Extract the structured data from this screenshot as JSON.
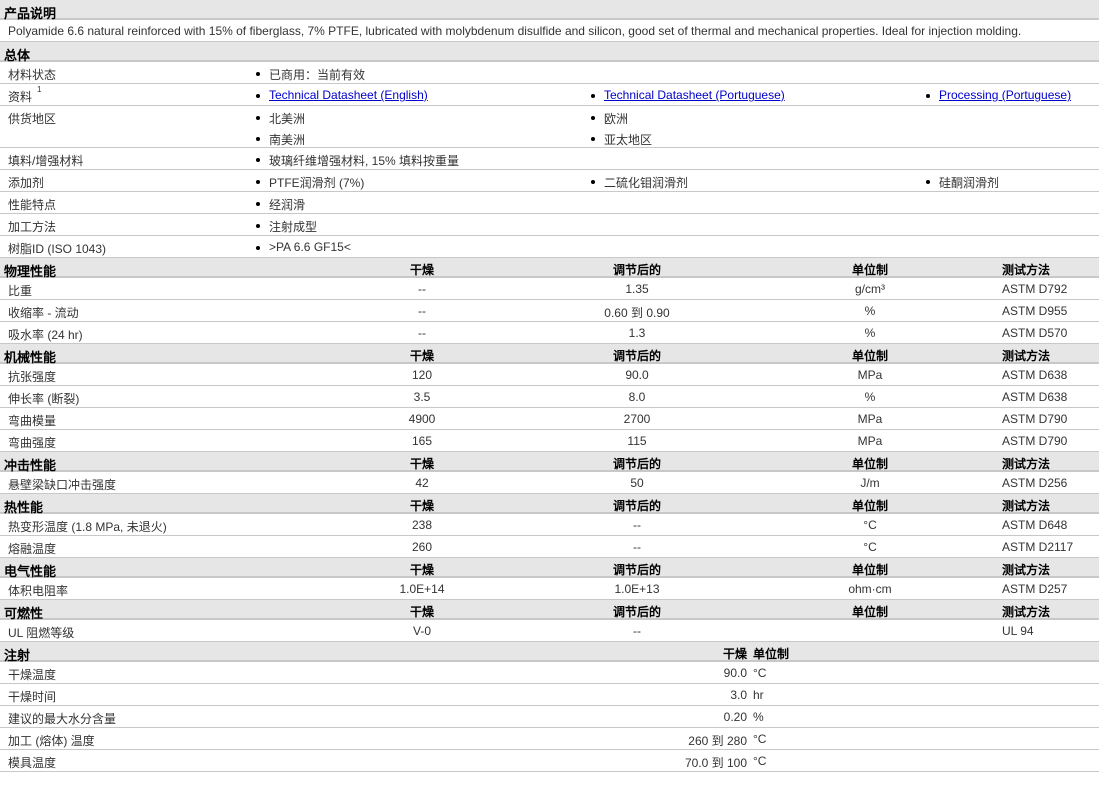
{
  "description": {
    "title": "产品说明",
    "text": "Polyamide 6.6 natural reinforced with 15% of fiberglass, 7% PTFE, lubricated with molybdenum disulfide and silicon, good set of thermal and mechanical properties. Ideal for injection molding."
  },
  "general": {
    "title": "总体",
    "rows": [
      {
        "label": "材料状态",
        "values": [
          "已商用：当前有效"
        ]
      },
      {
        "label": "资料",
        "sup": "1",
        "links": [
          "Technical Datasheet (English)",
          "Technical Datasheet (Portuguese)",
          "Processing (Portuguese)"
        ]
      },
      {
        "label": "供货地区",
        "values": [
          "北美洲",
          "欧洲",
          "南美洲",
          "亚太地区"
        ],
        "grid": true
      },
      {
        "label": "填料/增强材料",
        "values": [
          "玻璃纤维增强材料, 15% 填料按重量"
        ]
      },
      {
        "label": "添加剂",
        "values": [
          "PTFE润滑剂 (7%)",
          "二硫化钼润滑剂",
          "硅酮润滑剂"
        ]
      },
      {
        "label": "性能特点",
        "values": [
          "经润滑"
        ]
      },
      {
        "label": "加工方法",
        "values": [
          "注射成型"
        ]
      },
      {
        "label": "树脂ID (ISO 1043)",
        "values": [
          ">PA 6.6 GF15<"
        ]
      }
    ]
  },
  "sections": [
    {
      "title": "物理性能",
      "headers": [
        "干燥",
        "调节后的",
        "单位制",
        "测试方法"
      ],
      "rows": [
        [
          "比重",
          "--",
          "1.35",
          "g/cm³",
          "ASTM D792"
        ],
        [
          "收缩率 - 流动",
          "--",
          "0.60 到 0.90",
          "%",
          "ASTM D955"
        ],
        [
          "吸水率 (24 hr)",
          "--",
          "1.3",
          "%",
          "ASTM D570"
        ]
      ]
    },
    {
      "title": "机械性能",
      "headers": [
        "干燥",
        "调节后的",
        "单位制",
        "测试方法"
      ],
      "rows": [
        [
          "抗张强度",
          "120",
          "90.0",
          "MPa",
          "ASTM D638"
        ],
        [
          "伸长率 (断裂)",
          "3.5",
          "8.0",
          "%",
          "ASTM D638"
        ],
        [
          "弯曲模量",
          "4900",
          "2700",
          "MPa",
          "ASTM D790"
        ],
        [
          "弯曲强度",
          "165",
          "115",
          "MPa",
          "ASTM D790"
        ]
      ]
    },
    {
      "title": "冲击性能",
      "headers": [
        "干燥",
        "调节后的",
        "单位制",
        "测试方法"
      ],
      "rows": [
        [
          "悬壁梁缺口冲击强度",
          "42",
          "50",
          "J/m",
          "ASTM D256"
        ]
      ]
    },
    {
      "title": "热性能",
      "headers": [
        "干燥",
        "调节后的",
        "单位制",
        "测试方法"
      ],
      "rows": [
        [
          "热变形温度 (1.8 MPa, 未退火)",
          "238",
          "--",
          "°C",
          "ASTM D648"
        ],
        [
          "熔融温度",
          "260",
          "--",
          "°C",
          "ASTM D2117"
        ]
      ]
    },
    {
      "title": "电气性能",
      "headers": [
        "干燥",
        "调节后的",
        "单位制",
        "测试方法"
      ],
      "rows": [
        [
          "体积电阻率",
          "1.0E+14",
          "1.0E+13",
          "ohm·cm",
          "ASTM D257"
        ]
      ]
    },
    {
      "title": "可燃性",
      "headers": [
        "干燥",
        "调节后的",
        "单位制",
        "测试方法"
      ],
      "rows": [
        [
          "UL 阻燃等级",
          "V-0",
          "--",
          "",
          "UL 94"
        ]
      ]
    }
  ],
  "injection": {
    "title": "注射",
    "headers": [
      "干燥",
      "单位制"
    ],
    "rows": [
      [
        "干燥温度",
        "90.0",
        "°C"
      ],
      [
        "干燥时间",
        "3.0",
        "hr"
      ],
      [
        "建议的最大水分含量",
        "0.20",
        "%"
      ],
      [
        "加工 (熔体) 温度",
        "260 到 280",
        "°C"
      ],
      [
        "模具温度",
        "70.0 到 100",
        "°C"
      ]
    ]
  }
}
